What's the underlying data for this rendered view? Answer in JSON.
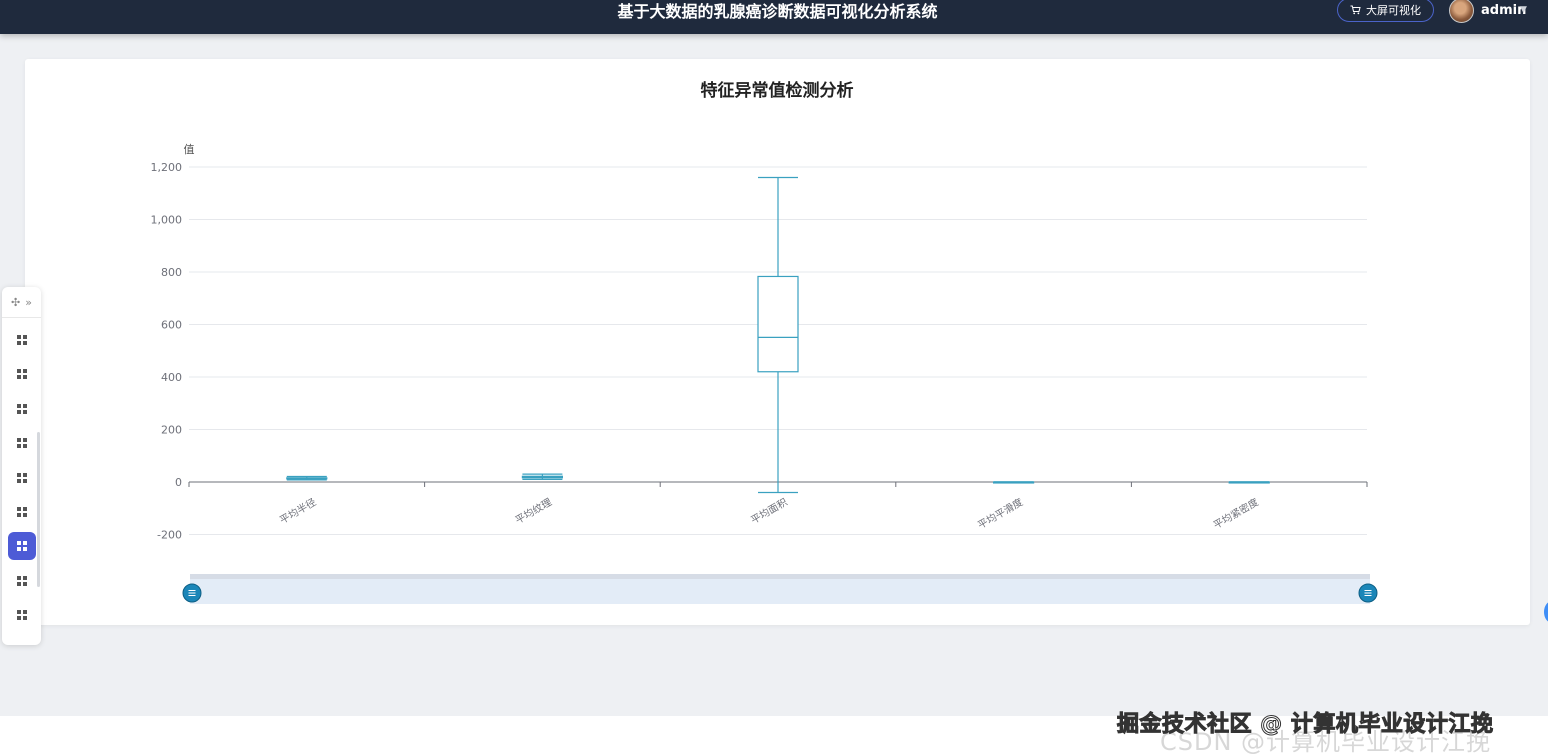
{
  "header": {
    "title": "基于大数据的乳腺癌诊断数据可视化分析系统",
    "screen_button": "大屏可视化",
    "user": "admin"
  },
  "toolbar": {
    "items": [
      "grid-icon",
      "grid-icon",
      "grid-icon",
      "grid-icon",
      "grid-icon",
      "grid-icon",
      "grid-icon",
      "grid-icon",
      "grid-icon"
    ],
    "active_index": 6
  },
  "colors": {
    "series": "#3aa1c0",
    "axis": "#6e7079",
    "grid": "#e6e8ec",
    "active": "#4d5bd6"
  },
  "chart_data": {
    "type": "boxplot",
    "title": "特征异常值检测分析",
    "ylabel": "值",
    "ylim": [
      -200,
      1200
    ],
    "yticks": [
      "-200",
      "0",
      "200",
      "400",
      "600",
      "800",
      "1,000",
      "1,200"
    ],
    "categories": [
      "平均半径",
      "平均纹理",
      "平均面积",
      "平均平滑度",
      "平均紧密度"
    ],
    "boxes": [
      {
        "category": "平均半径",
        "min": 8,
        "q1": 12,
        "median": 13.4,
        "q3": 15.8,
        "max": 21
      },
      {
        "category": "平均纹理",
        "min": 10,
        "q1": 16,
        "median": 18.8,
        "q3": 21.8,
        "max": 30
      },
      {
        "category": "平均面积",
        "min": -40,
        "q1": 420,
        "median": 551,
        "q3": 783,
        "max": 1160
      },
      {
        "category": "平均平滑度",
        "min": 0.06,
        "q1": 0.086,
        "median": 0.096,
        "q3": 0.105,
        "max": 0.13
      },
      {
        "category": "平均紧密度",
        "min": 0.02,
        "q1": 0.065,
        "median": 0.093,
        "q3": 0.13,
        "max": 0.23
      }
    ],
    "grid": true,
    "datazoom": {
      "start": 0,
      "end": 100
    }
  },
  "watermark": {
    "main": "掘金技术社区 @ 计算机毕业设计江挽",
    "sub": "CSDN @计算机毕业设计江挽"
  }
}
